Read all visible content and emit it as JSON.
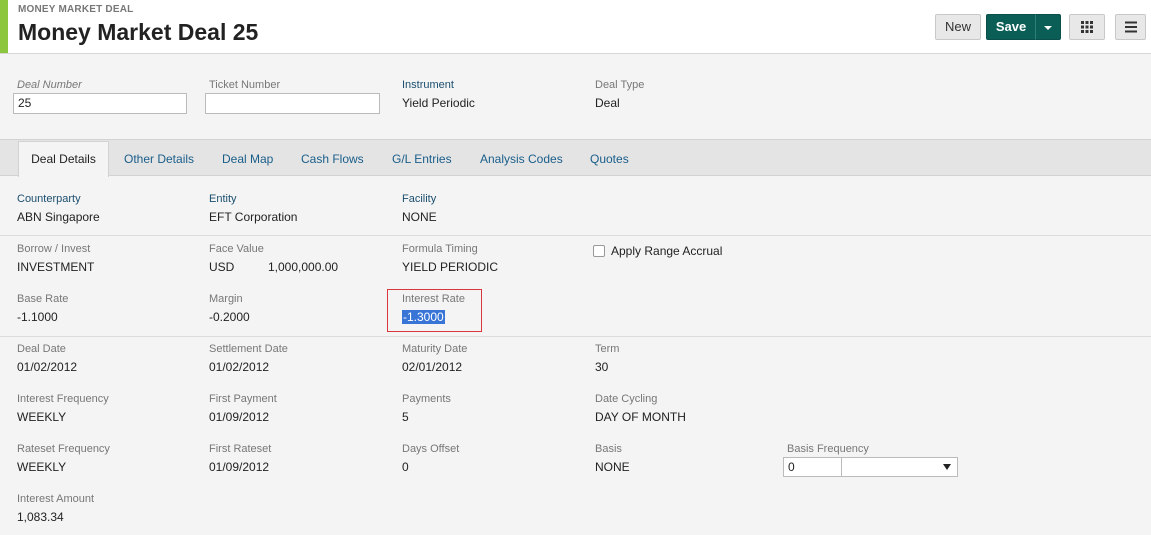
{
  "header": {
    "breadcrumb": "MONEY MARKET DEAL",
    "title": "Money Market Deal 25",
    "new_label": "New",
    "save_label": "Save"
  },
  "top_fields": {
    "deal_number": {
      "label": "Deal Number",
      "value": "25"
    },
    "ticket_number": {
      "label": "Ticket Number",
      "value": ""
    },
    "instrument": {
      "label": "Instrument",
      "value": "Yield Periodic"
    },
    "deal_type": {
      "label": "Deal Type",
      "value": "Deal"
    }
  },
  "tabs": [
    {
      "label": "Deal Details",
      "active": true
    },
    {
      "label": "Other Details"
    },
    {
      "label": "Deal Map"
    },
    {
      "label": "Cash Flows"
    },
    {
      "label": "G/L Entries"
    },
    {
      "label": "Analysis Codes"
    },
    {
      "label": "Quotes"
    }
  ],
  "details": {
    "counterparty": {
      "label": "Counterparty",
      "value": "ABN Singapore"
    },
    "entity": {
      "label": "Entity",
      "value": "EFT Corporation"
    },
    "facility": {
      "label": "Facility",
      "value": "NONE"
    },
    "borrow_invest": {
      "label": "Borrow / Invest",
      "value": "INVESTMENT"
    },
    "face_value": {
      "label": "Face Value",
      "currency": "USD",
      "amount": "1,000,000.00"
    },
    "formula_timing": {
      "label": "Formula Timing",
      "value": "YIELD PERIODIC"
    },
    "apply_range_accrual": {
      "label": "Apply Range Accrual",
      "checked": false
    },
    "base_rate": {
      "label": "Base Rate",
      "value": "-1.1000"
    },
    "margin": {
      "label": "Margin",
      "value": "-0.2000"
    },
    "interest_rate": {
      "label": "Interest Rate",
      "value": "-1.3000"
    },
    "deal_date": {
      "label": "Deal Date",
      "value": "01/02/2012"
    },
    "settlement_date": {
      "label": "Settlement Date",
      "value": "01/02/2012"
    },
    "maturity_date": {
      "label": "Maturity Date",
      "value": "02/01/2012"
    },
    "term": {
      "label": "Term",
      "value": "30"
    },
    "interest_frequency": {
      "label": "Interest Frequency",
      "value": "WEEKLY"
    },
    "first_payment": {
      "label": "First Payment",
      "value": "01/09/2012"
    },
    "payments": {
      "label": "Payments",
      "value": "5"
    },
    "date_cycling": {
      "label": "Date Cycling",
      "value": "DAY OF MONTH"
    },
    "rateset_frequency": {
      "label": "Rateset Frequency",
      "value": "WEEKLY"
    },
    "first_rateset": {
      "label": "First Rateset",
      "value": "01/09/2012"
    },
    "days_offset": {
      "label": "Days Offset",
      "value": "0"
    },
    "basis": {
      "label": "Basis",
      "value": "NONE"
    },
    "basis_frequency": {
      "label": "Basis Frequency",
      "value": "0",
      "select_value": ""
    },
    "interest_amount": {
      "label": "Interest Amount",
      "value": "1,083.34"
    }
  },
  "colors": {
    "accent": "#8cc63f",
    "save_button": "#0b5e56",
    "link": "#1a5e8a",
    "highlight_border": "#d9363e",
    "selection": "#3875d7"
  }
}
